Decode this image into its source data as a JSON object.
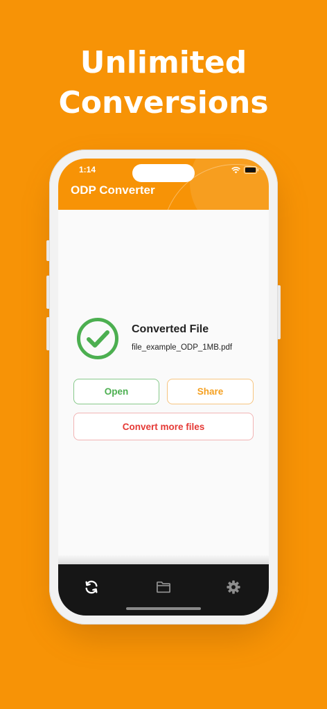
{
  "headline": {
    "line1": "Unlimited",
    "line2": "Conversions"
  },
  "status_bar": {
    "time": "1:14",
    "icons": [
      "wifi-icon",
      "battery-icon"
    ]
  },
  "appbar": {
    "title": "ODP Converter"
  },
  "result": {
    "status_icon": "check-circle-icon",
    "title": "Converted File",
    "filename": "file_example_ODP_1MB.pdf"
  },
  "actions": {
    "open_label": "Open",
    "share_label": "Share",
    "convert_more_label": "Convert more files"
  },
  "bottom_nav": {
    "items": [
      {
        "icon": "sync-icon",
        "active": true
      },
      {
        "icon": "folder-icon",
        "active": false
      },
      {
        "icon": "gear-icon",
        "active": false
      }
    ]
  },
  "colors": {
    "brand_orange": "#F79306",
    "success_green": "#4CAF50",
    "share_orange": "#F5A020",
    "danger_red": "#E53935",
    "nav_background": "#161616"
  }
}
